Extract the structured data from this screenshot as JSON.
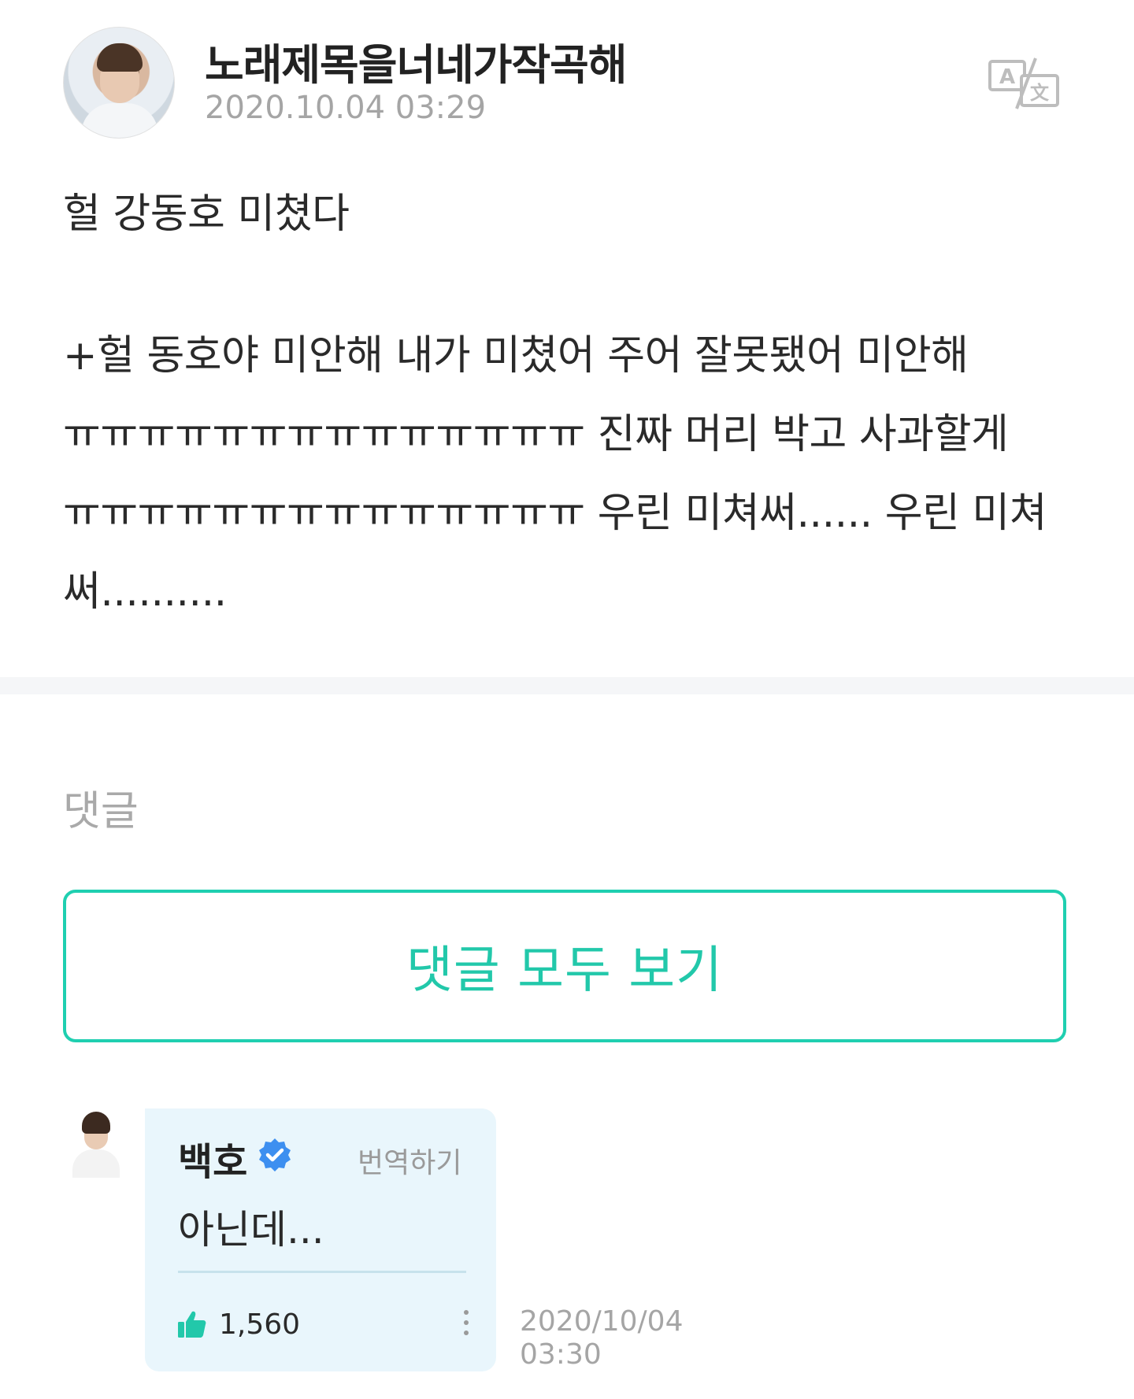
{
  "post": {
    "author": "노래제목을너네가작곡해",
    "date": "2020.10.04 03:29",
    "translate_icon": "translate-icon",
    "body_line_1": "헐 강동호 미쳤다",
    "body_line_2": "+헐 동호야 미안해 내가 미쳤어 주어 잘못됐어 미안해",
    "body_line_3": "ㅠㅠㅠㅠㅠㅠㅠㅠㅠㅠㅠㅠㅠㅠ 진짜 머리 박고 사과할게",
    "body_line_4": "ㅠㅠㅠㅠㅠㅠㅠㅠㅠㅠㅠㅠㅠㅠ 우린 미쳐써...... 우린 미쳐",
    "body_line_5": "써.........."
  },
  "comments_section": {
    "label": "댓글",
    "view_all_label": "댓글 모두 보기"
  },
  "comment": {
    "author": "백호",
    "verified_icon": "verified-badge-icon",
    "translate_label": "번역하기",
    "text": "아닌데...",
    "like_icon": "thumbs-up-icon",
    "likes": "1,560",
    "more_icon": "more-vertical-icon",
    "date_line_1": "2020/10/04",
    "date_line_2": "03:30"
  },
  "colors": {
    "accent": "#22c8aa",
    "bubble": "#e9f6fc",
    "muted": "#a5a5a5",
    "verified": "#3d8ff0",
    "like": "#22c8aa"
  }
}
